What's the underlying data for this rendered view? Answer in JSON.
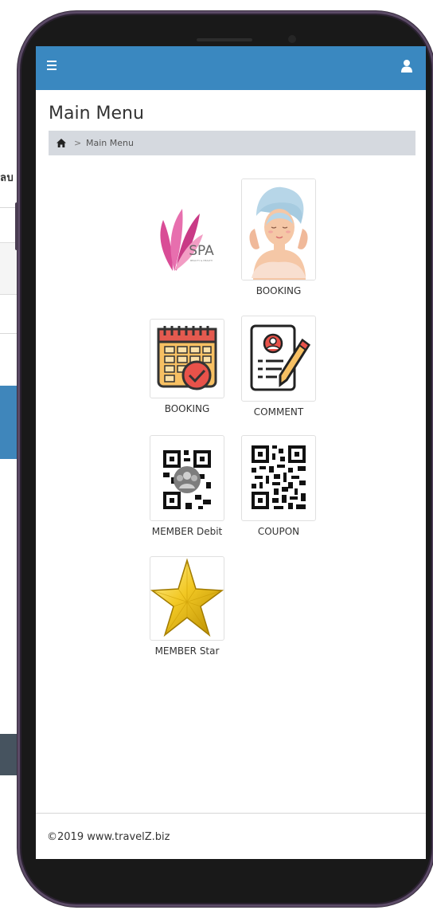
{
  "background": {
    "fragment_text": "ลบ"
  },
  "app": {
    "topbar": {
      "menu_icon": "hamburger-icon",
      "user_icon": "user-icon",
      "accent": "#3a88c0"
    },
    "page_title": "Main Menu",
    "breadcrumb": {
      "home_icon": "home-icon",
      "separator": ">",
      "current": "Main Menu"
    },
    "spa_logo": {
      "text": "SPA",
      "tagline": "BEAUTY & HEALTH"
    },
    "menu": [
      {
        "label": "BOOKING",
        "icon": "spa-towel-woman-icon"
      },
      {
        "label": "BOOKING",
        "icon": "calendar-check-icon"
      },
      {
        "label": "COMMENT",
        "icon": "document-pen-icon"
      },
      {
        "label": "MEMBER Debit",
        "icon": "qr-member-icon"
      },
      {
        "label": "COUPON",
        "icon": "qr-coupon-icon"
      },
      {
        "label": "MEMBER Star",
        "icon": "gold-star-icon"
      }
    ],
    "footer": {
      "copyright": "©2019 www.travelZ.biz"
    }
  }
}
